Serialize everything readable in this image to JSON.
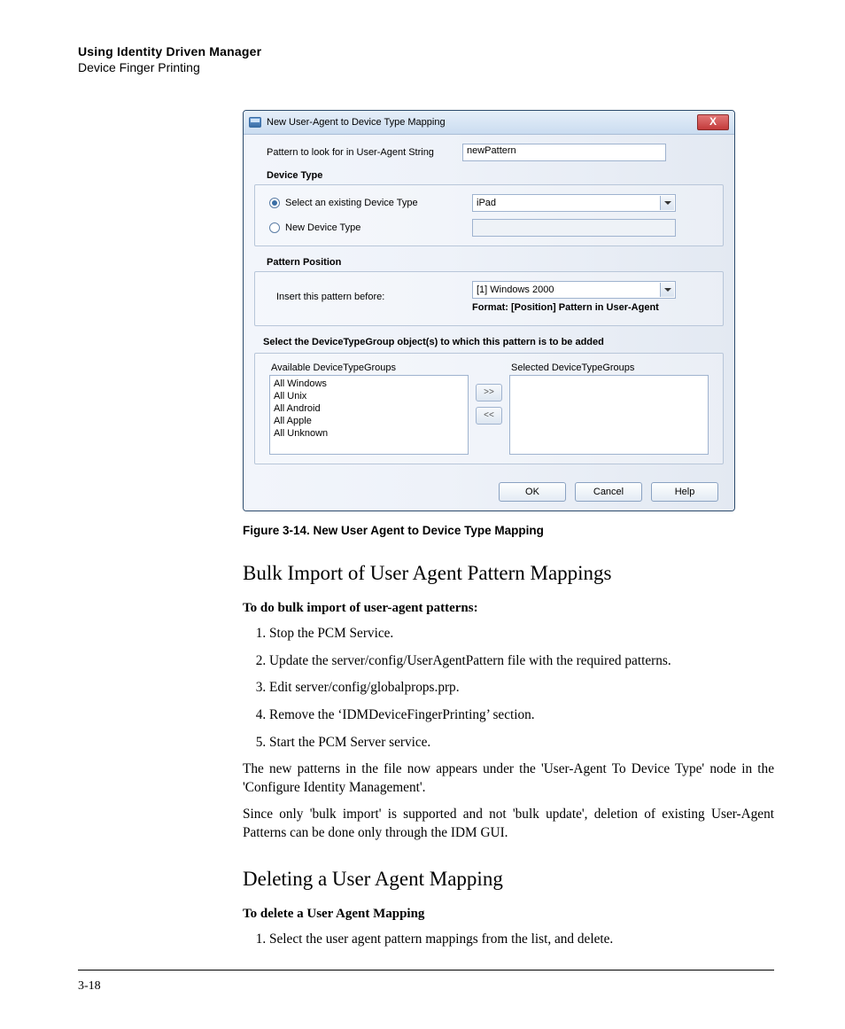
{
  "header": {
    "title": "Using Identity Driven Manager",
    "subtitle": "Device Finger Printing"
  },
  "dialog": {
    "title": "New User-Agent to Device Type Mapping",
    "close": "X",
    "pattern_label": "Pattern to look for in User-Agent String",
    "pattern_value": "newPattern",
    "device_type_label": "Device Type",
    "radio_existing": "Select an existing Device Type",
    "radio_new": "New Device Type",
    "existing_value": "iPad",
    "position_label": "Pattern Position",
    "insert_label": "Insert this pattern before:",
    "insert_value": "[1] Windows 2000",
    "format_note": "Format: [Position] Pattern in User-Agent",
    "group_instr": "Select the DeviceTypeGroup object(s) to which this pattern is to be added",
    "avail_label": "Available DeviceTypeGroups",
    "sel_label": "Selected DeviceTypeGroups",
    "avail_items": [
      "All Windows",
      "All Unix",
      "All Android",
      "All Apple",
      "All Unknown"
    ],
    "move_r": ">>",
    "move_l": "<<",
    "ok": "OK",
    "cancel": "Cancel",
    "help": "Help"
  },
  "caption": "Figure 3-14. New User Agent to Device Type Mapping",
  "section1": {
    "heading": "Bulk Import of User Agent Pattern Mappings",
    "intro": "To do bulk import of user-agent patterns:",
    "steps": [
      "Stop the PCM Service.",
      "Update the server/config/UserAgentPattern file with the required patterns.",
      "Edit server/config/globalprops.prp.",
      "Remove the ‘IDMDeviceFingerPrinting’ section.",
      "Start the PCM Server service."
    ],
    "p1": "The new patterns in the file now appears under the 'User-Agent To Device Type' node in the 'Configure Identity Management'.",
    "p2": "Since only 'bulk import' is supported and not 'bulk update', deletion of existing User-Agent Patterns can be done only through the IDM GUI."
  },
  "section2": {
    "heading": "Deleting a User Agent Mapping",
    "intro": "To delete a User Agent Mapping",
    "steps": [
      "Select the user agent pattern mappings from the list, and delete."
    ]
  },
  "page_num": "3-18"
}
